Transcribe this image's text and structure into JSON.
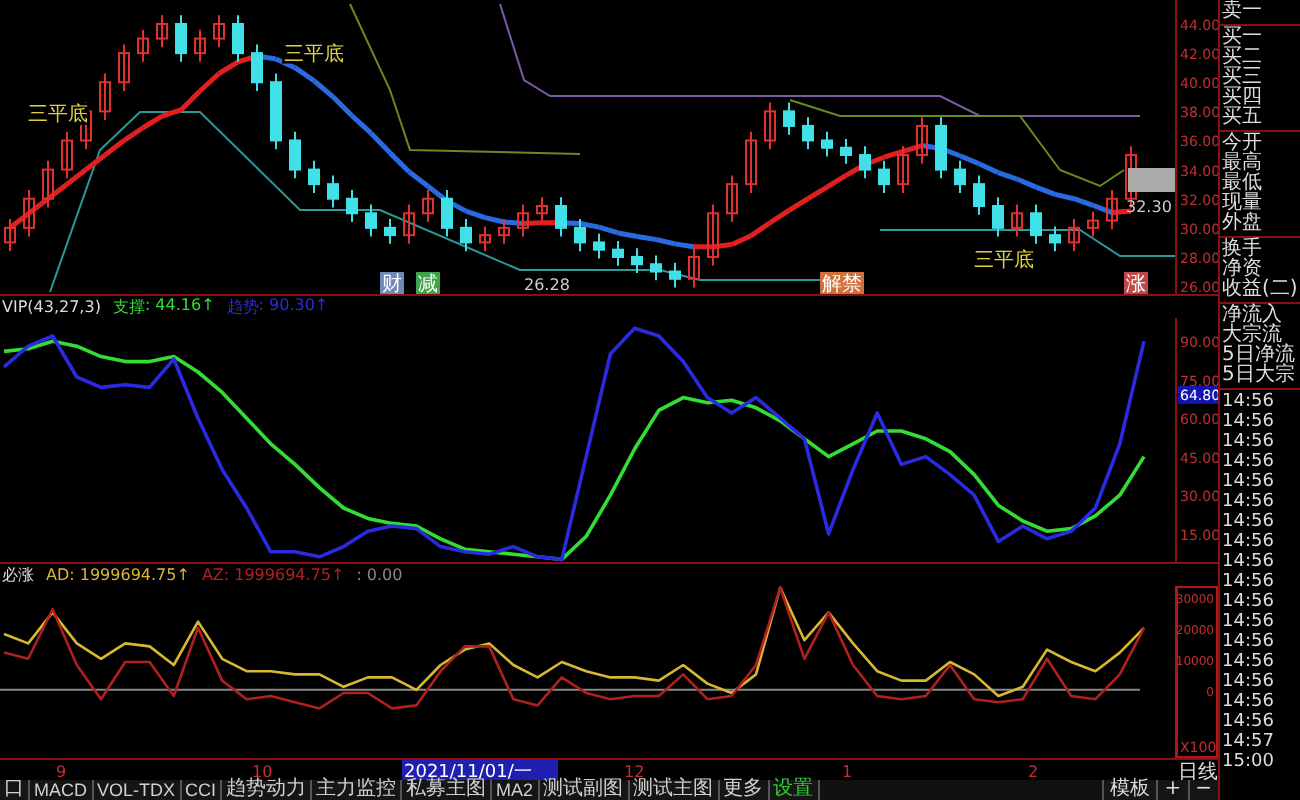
{
  "price_chart": {
    "axis": [
      "44.00",
      "42.00",
      "40.00",
      "38.00",
      "36.00",
      "34.00",
      "32.00",
      "30.00",
      "28.00",
      "26.00"
    ],
    "pattern_labels": [
      "三平底",
      "三平底",
      "三平底"
    ],
    "low_label": "26.28",
    "last_price": "32.30",
    "event_tags": [
      {
        "text": "财",
        "color": "#7088b8"
      },
      {
        "text": "减",
        "color": "#3fa34a"
      },
      {
        "text": "解禁",
        "color": "#d0703a"
      },
      {
        "text": "涨",
        "color": "#c04848"
      }
    ]
  },
  "oscillator": {
    "title": "VIP(43,27,3)",
    "legend": [
      ": 44.16↑",
      ": 90.30↑"
    ],
    "current_marker": "64.80",
    "chart_data": {
      "type": "line",
      "categories": [
        null,
        null,
        null,
        null,
        null,
        null,
        null,
        null,
        null,
        null,
        null,
        null,
        null,
        null,
        null,
        null,
        null,
        null,
        null,
        null,
        null,
        null,
        null,
        null,
        null,
        null,
        null,
        null,
        null,
        null,
        null,
        null,
        null,
        null,
        null,
        null,
        null,
        null,
        null,
        null,
        null,
        null,
        null,
        null,
        null,
        null,
        null,
        null
      ],
      "ylim": [
        4,
        99
      ],
      "yticks": [
        {
          "value": 90,
          "label": "90.00"
        },
        {
          "value": 75,
          "label": "75.00"
        },
        {
          "value": 60,
          "label": "60.00"
        },
        {
          "value": 45,
          "label": "45.00"
        },
        {
          "value": 30,
          "label": "30.00"
        },
        {
          "value": 15,
          "label": "15.00"
        }
      ],
      "series": [
        {
          "name": "支撑",
          "color": "#33dd33",
          "values": [
            86,
            87,
            90,
            88,
            84,
            82,
            82,
            84,
            78,
            70,
            60,
            50,
            42,
            33,
            25,
            21,
            19,
            18,
            13,
            9,
            8,
            7,
            6,
            5,
            14,
            30,
            48,
            63,
            68,
            66,
            67,
            64,
            59,
            52,
            45,
            50,
            55,
            55,
            52,
            47,
            38,
            26,
            20,
            16,
            17,
            22,
            30,
            45
          ]
        },
        {
          "name": "趋势",
          "color": "#2a2ae0",
          "values": [
            80,
            88,
            92,
            76,
            72,
            73,
            72,
            83,
            60,
            40,
            25,
            8,
            8,
            6,
            10,
            16,
            18,
            17,
            10,
            8,
            7,
            10,
            6,
            5,
            45,
            85,
            95,
            92,
            82,
            68,
            62,
            68,
            60,
            52,
            15,
            40,
            62,
            42,
            45,
            38,
            30,
            12,
            18,
            13,
            16,
            25,
            50,
            90
          ]
        }
      ]
    }
  },
  "flow": {
    "title": "必涨",
    "legend": [
      ": 1999694.75↑",
      ": 1999694.75↑"
    ],
    "extra": ": 0.00",
    "scale": "X100",
    "chart_data": {
      "type": "line",
      "categories": [
        null,
        null,
        null,
        null,
        null,
        null,
        null,
        null,
        null,
        null,
        null,
        null,
        null,
        null,
        null,
        null,
        null,
        null,
        null,
        null,
        null,
        null,
        null,
        null,
        null,
        null,
        null,
        null,
        null,
        null,
        null,
        null,
        null,
        null,
        null,
        null,
        null,
        null,
        null,
        null,
        null,
        null,
        null,
        null,
        null,
        null,
        null,
        null
      ],
      "ylim": [
        -22000,
        33500
      ],
      "yticks": [
        30000,
        20000,
        10000,
        0
      ],
      "series": [
        {
          "name": "AD",
          "color": "#d8b830",
          "values": [
            18000,
            15000,
            25000,
            15000,
            10000,
            15000,
            14000,
            8000,
            22000,
            10000,
            6000,
            6000,
            5000,
            5000,
            1000,
            4000,
            4000,
            0,
            8000,
            13000,
            15000,
            8000,
            4000,
            9000,
            6000,
            4000,
            4000,
            3000,
            8000,
            2000,
            -1000,
            5000,
            33000,
            16000,
            25000,
            15000,
            6000,
            3000,
            3000,
            9000,
            5000,
            -2000,
            1000,
            13000,
            9000,
            6000,
            12000,
            20000
          ]
        },
        {
          "name": "AZ",
          "color": "#b02020",
          "values": [
            12000,
            10000,
            26000,
            8000,
            -3000,
            9000,
            9000,
            -2000,
            20000,
            3000,
            -3000,
            -2000,
            -4000,
            -6000,
            -1000,
            -1000,
            -6000,
            -5000,
            6000,
            14000,
            14000,
            -3000,
            -5000,
            4000,
            -1000,
            -3000,
            -2000,
            -2000,
            5000,
            -3000,
            -2000,
            8000,
            33000,
            10000,
            25000,
            8000,
            -2000,
            -3000,
            -2000,
            8000,
            -3000,
            -4000,
            -3000,
            10000,
            -2000,
            -3000,
            5000,
            20000
          ]
        }
      ]
    }
  },
  "date_axis": [
    {
      "label": "9",
      "selected": false
    },
    {
      "label": "10",
      "selected": false
    },
    {
      "label": "2021/11/01/一",
      "selected": true
    },
    {
      "label": "12",
      "selected": false
    },
    {
      "label": "1",
      "selected": false
    },
    {
      "label": "2",
      "selected": false
    }
  ],
  "period": "日线",
  "tabs": [
    {
      "label": "口",
      "kind": "tab"
    },
    {
      "label": "MACD",
      "kind": "tab"
    },
    {
      "label": "VOL-TDX",
      "kind": "tab"
    },
    {
      "label": "CCI",
      "kind": "tab"
    },
    {
      "label": "趋势动力",
      "kind": "tab"
    },
    {
      "label": "主力监控",
      "kind": "tab"
    },
    {
      "label": "私募主图",
      "kind": "tab"
    },
    {
      "label": "MA2",
      "kind": "tab"
    },
    {
      "label": "测试副图",
      "kind": "tab"
    },
    {
      "label": "测试主图",
      "kind": "tab"
    },
    {
      "label": "更多",
      "kind": "tab"
    },
    {
      "label": "设置",
      "kind": "settings"
    }
  ],
  "template_button": "模板",
  "zoom_buttons": [
    "+",
    "−"
  ],
  "quote_panel": {
    "sections": [
      [
        "卖一"
      ],
      [
        "买一",
        "买二",
        "买三",
        "买四",
        "买五"
      ],
      [
        "今开",
        "最高",
        "最低",
        "现量",
        "外盘"
      ],
      [
        "换手",
        "净资",
        "收益(二)"
      ],
      [
        "净流入",
        "大宗流",
        "5日净流",
        "5日大宗"
      ]
    ],
    "times": [
      "14:56",
      "14:56",
      "14:56",
      "14:56",
      "14:56",
      "14:56",
      "14:56",
      "14:56",
      "14:56",
      "14:56",
      "14:56",
      "14:56",
      "14:56",
      "14:56",
      "14:56",
      "14:56",
      "14:56",
      "14:57",
      "15:00"
    ]
  }
}
